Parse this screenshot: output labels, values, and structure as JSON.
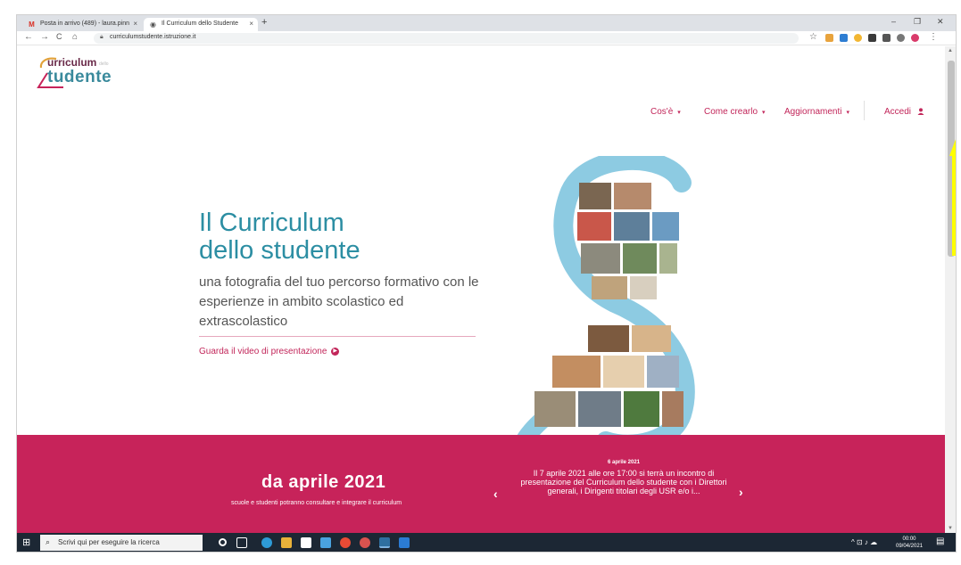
{
  "browser": {
    "tabs": [
      {
        "label": "Posta in arrivo (489) - laura.pinn",
        "close": "×"
      },
      {
        "label": "Il Curriculum dello Studente",
        "close": "×"
      }
    ],
    "new_tab": "+",
    "window_controls": {
      "minimize": "–",
      "maximize": "❐",
      "close": "✕"
    },
    "url": "curriculumstudente.istruzione.it",
    "nav": {
      "back": "←",
      "forward": "→",
      "reload": "C",
      "home": "⌂"
    },
    "star": "☆",
    "menu": "⋮"
  },
  "site": {
    "logo": {
      "line1": "urriculum",
      "line1_small": "dello",
      "line2": "tudente"
    },
    "menu": [
      {
        "label": "Cos'è"
      },
      {
        "label": "Come crearlo"
      },
      {
        "label": "Aggiornamenti"
      }
    ],
    "caret": "▾",
    "login": {
      "label": "Accedi",
      "icon": "👤"
    },
    "hero": {
      "title_line1": "Il Curriculum",
      "title_line2": "dello studente",
      "subtitle": "una fotografia del tuo percorso formativo con le esperienze in ambito scolastico ed extrascolastico",
      "video_link": "Guarda il video di presentazione",
      "play_icon": "▶"
    },
    "banner": {
      "title": "da aprile 2021",
      "subtitle": "scuole e studenti potranno consultare e integrare il curriculum",
      "news_date": "6 aprile 2021",
      "news_text": "Il 7 aprile 2021 alle ore 17:00 si terrà un incontro di presentazione del Curriculum dello studente con i Direttori generali, i Dirigenti titolari degli USR e/o i...",
      "arrow_left": "‹",
      "arrow_right": "›",
      "slides": 4,
      "active_slide": 3
    }
  },
  "scrollbar": {
    "up": "▲",
    "down": "▼"
  },
  "taskbar": {
    "start_icon": "⊞",
    "search_placeholder": "Scrivi qui per eseguire la ricerca",
    "search_icon": "⌕",
    "tray_icons": "^ ⊡ ♪ ☁",
    "time": "00:00",
    "date": "09/04/2021",
    "notification_icon": "▤"
  },
  "colors": {
    "accent": "#c7235a",
    "teal": "#2c8ea3",
    "light_blue": "#8dcbe2",
    "taskbar": "#1c2734",
    "annotation": "#ffff00"
  }
}
